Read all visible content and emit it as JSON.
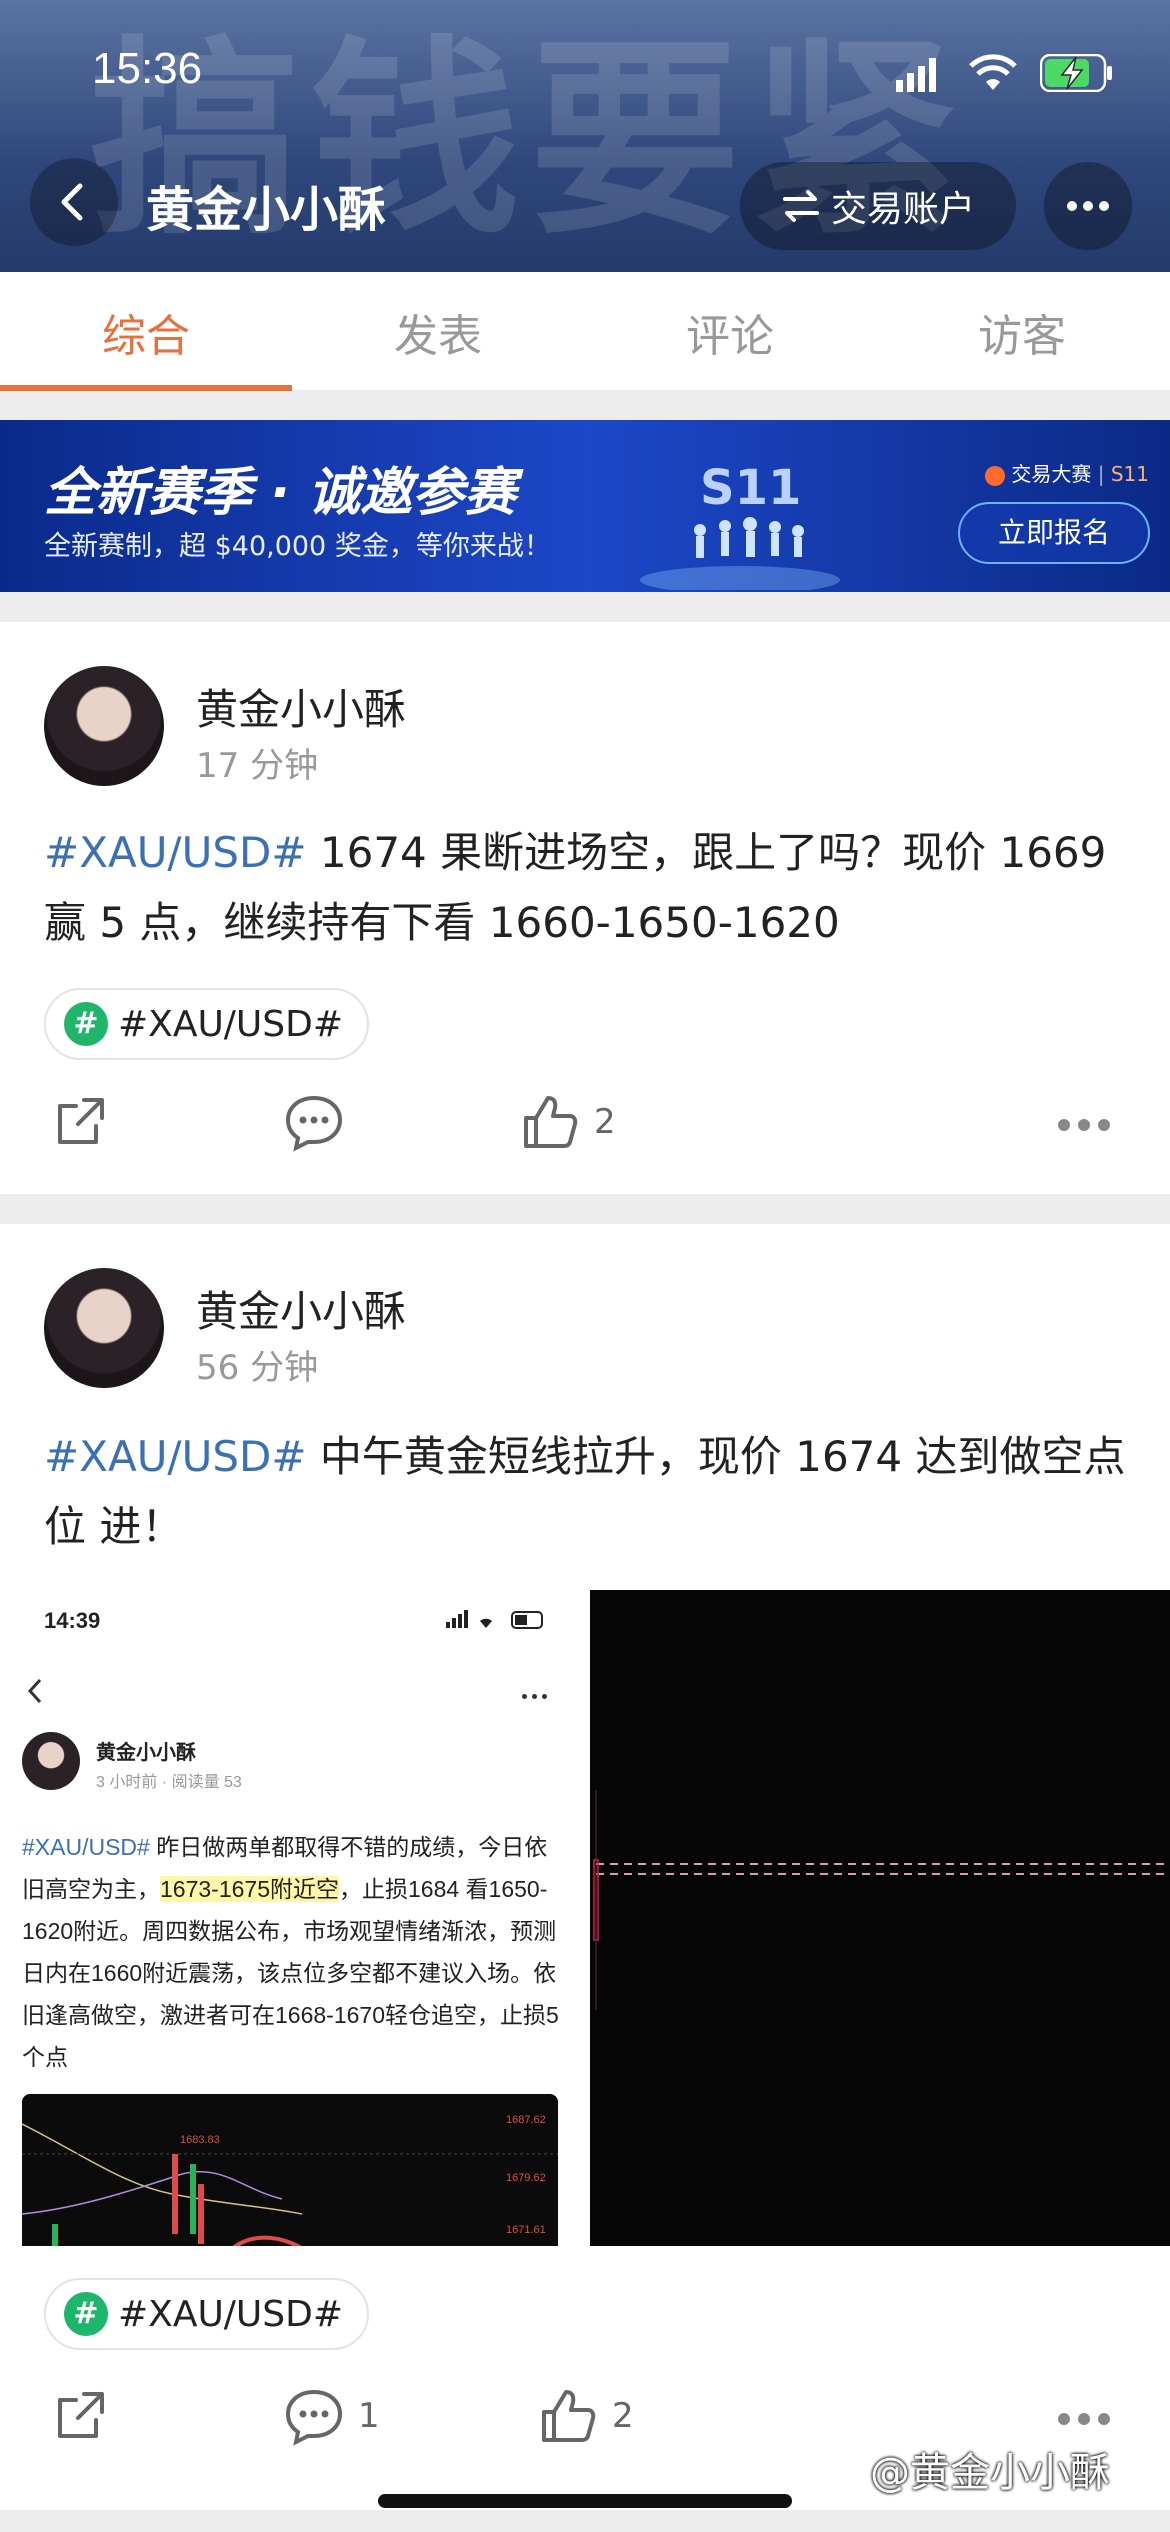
{
  "status_bar": {
    "time": "15:36",
    "icons": [
      "signal-icon",
      "wifi-icon",
      "battery-charging-icon"
    ]
  },
  "header": {
    "background_text": "搞钱要紧",
    "title": "黄金小小酥",
    "trade_button": "交易账户",
    "icons": [
      "back-icon",
      "swap-icon",
      "more-icon"
    ]
  },
  "tabs": [
    {
      "label": "综合",
      "active": true
    },
    {
      "label": "发表",
      "active": false
    },
    {
      "label": "评论",
      "active": false
    },
    {
      "label": "访客",
      "active": false
    }
  ],
  "banner": {
    "title": "全新赛季 · 诚邀参赛",
    "subtitle": "全新赛制，超 $40,000 奖金，等你来战！",
    "season": "S11",
    "logo_text": "交易大赛",
    "logo_season": "S11",
    "button": "立即报名"
  },
  "posts": [
    {
      "author": "黄金小小酥",
      "time": "17 分钟",
      "tag": "#XAU/USD#",
      "text": " 1674 果断进场空，跟上了吗？现价 1669 赢 5 点，继续持有下看 1660-1650-1620",
      "topic": "#XAU/USD#",
      "comments": "",
      "likes": "2"
    },
    {
      "author": "黄金小小酥",
      "time": "56 分钟",
      "tag": "#XAU/USD#",
      "text": " 中午黄金短线拉升，现价 1674 达到做空点位 进！",
      "topic": "#XAU/USD#",
      "comments": "1",
      "likes": "2",
      "embedded_screenshot": {
        "time": "14:39",
        "author": "黄金小小酥",
        "meta": "3 小时前 · 阅读量 53",
        "tag": "#XAU/USD#",
        "text_part1": " 昨日做两单都取得不错的成绩，今日依旧高空为主，",
        "highlight": "1673-1675附近空",
        "text_part2": "，止损1684 看1650-1620附近。周四数据公布，市场观望情绪渐浓，预测日内在1660附近震荡，该点位多空都不建议入场。依旧逢高做空，激进者可在1668-1670轻仓追空，止损5个点",
        "chart_labels": [
          "1683.83",
          "1687.62",
          "1679.62",
          "1671.61"
        ]
      }
    }
  ],
  "watermark": "@黄金小小酥",
  "colors": {
    "accent": "#e8703a",
    "hashtag": "#3b6fb6",
    "topic_badge": "#1db66b"
  }
}
